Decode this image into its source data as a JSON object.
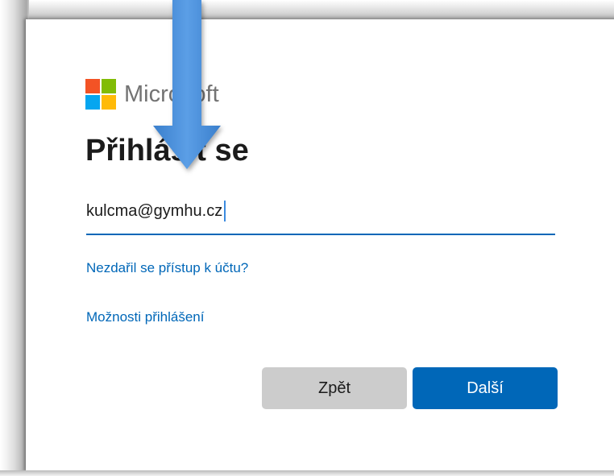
{
  "logo": {
    "text": "Microsoft"
  },
  "title": "Přihlásit se",
  "email": {
    "value": "kulcma@gymhu.cz"
  },
  "links": {
    "cant_access": "Nezdařil se přístup k účtu?",
    "signin_options": "Možnosti přihlášení"
  },
  "buttons": {
    "back": "Zpět",
    "next": "Další"
  },
  "colors": {
    "accent": "#0067b8",
    "back_button": "#cccccc",
    "arrow": "#4a90d9"
  },
  "overlay": {
    "icon": "arrow-down-icon"
  }
}
